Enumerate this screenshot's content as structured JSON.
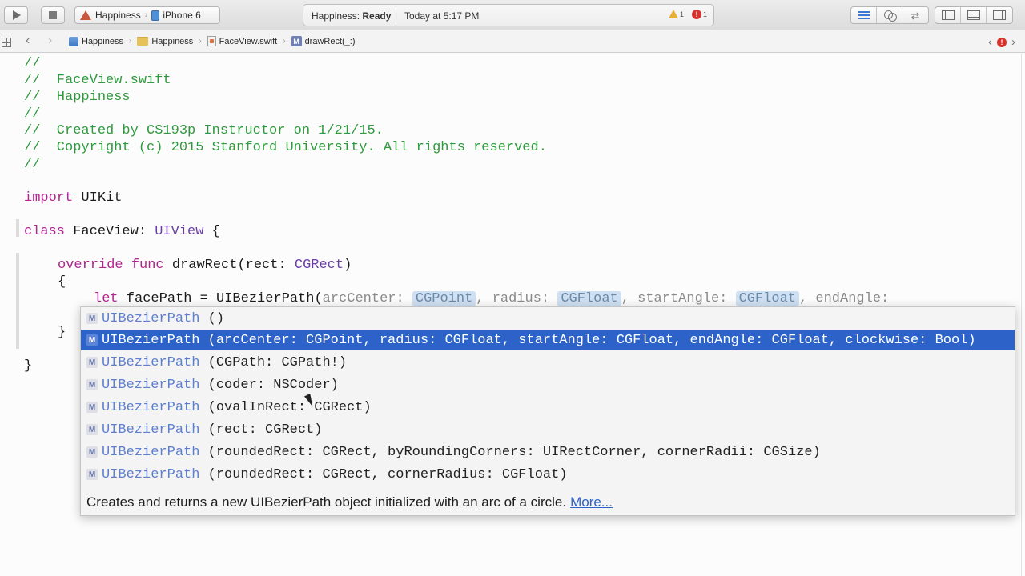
{
  "toolbar": {
    "scheme_project": "Happiness",
    "scheme_separator": "›",
    "scheme_device": "iPhone 6",
    "status_app": "Happiness:",
    "status_state": "Ready",
    "status_divider": "|",
    "status_time": "Today at 5:17 PM",
    "warning_count": "1",
    "error_count": "1",
    "icons": [
      "play-icon",
      "stop-icon",
      "standard-editor-icon",
      "assistant-editor-icon",
      "version-editor-icon",
      "navigator-pane-icon",
      "debug-pane-icon",
      "utilities-pane-icon"
    ]
  },
  "jumpbar": {
    "back": "‹",
    "forward": "›",
    "crumbs": [
      "Happiness",
      "Happiness",
      "FaceView.swift",
      "drawRect(_:)"
    ],
    "crumb_separator": "›",
    "method_marker": "M",
    "right_prev": "‹",
    "right_error": "!",
    "right_next": "›"
  },
  "editor": {
    "lines": [
      "//",
      "//  FaceView.swift",
      "//  Happiness",
      "//",
      "//  Created by CS193p Instructor on 1/21/15.",
      "//  Copyright (c) 2015 Stanford University. All rights reserved.",
      "//"
    ],
    "import_kw": "import",
    "import_module": " UIKit",
    "class_kw": "class",
    "class_name": " FaceView: ",
    "class_super": "UIView",
    "class_open": " {",
    "override_kw": "override",
    "func_kw": " func",
    "func_sig": " drawRect(rect: ",
    "func_type": "CGRect",
    "func_close": ")",
    "open_brace": "{",
    "let_kw": "let",
    "let_body": " facePath = UIBezierPath(",
    "ph_arc_label": "arcCenter: ",
    "ph_arc_type": "CGPoint",
    "ph_sep1": ", radius: ",
    "ph_radius_type": "CGFloat",
    "ph_sep2": ", startAngle: ",
    "ph_start_type": "CGFloat",
    "ph_sep3": ", endAngle:",
    "close_brace_inner": "}",
    "close_brace_outer": "}"
  },
  "completion": {
    "marker": "M",
    "name": "UIBezierPath",
    "items": [
      " ()",
      " (arcCenter: CGPoint, radius: CGFloat, startAngle: CGFloat, endAngle: CGFloat, clockwise: Bool)",
      " (CGPath: CGPath!)",
      " (coder: NSCoder)",
      " (ovalInRect: CGRect)",
      " (rect: CGRect)",
      " (roundedRect: CGRect, byRoundingCorners: UIRectCorner, cornerRadii: CGSize)",
      " (roundedRect: CGRect, cornerRadius: CGFloat)"
    ],
    "selected_index": 1,
    "description": "Creates and returns a new UIBezierPath object initialized with an arc of a circle.",
    "more_link": "More..."
  },
  "colors": {
    "comment": "#2f9a3d",
    "keyword": "#b0268f",
    "type": "#6b3ea7",
    "selection": "#2d63c8"
  }
}
